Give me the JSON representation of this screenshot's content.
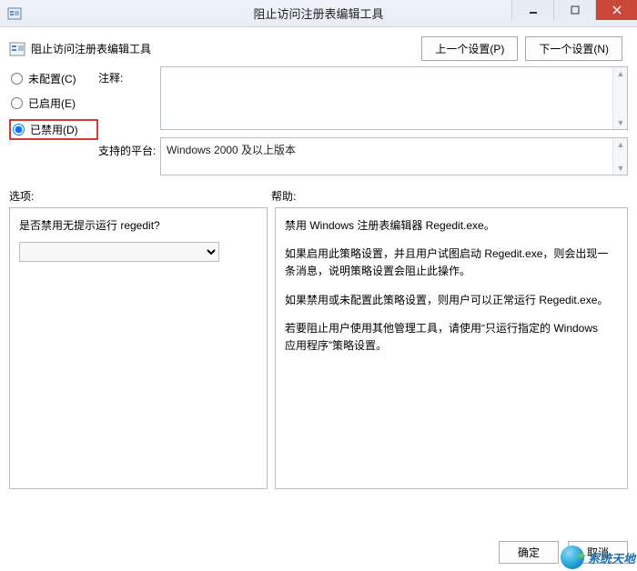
{
  "window": {
    "title": "阻止访问注册表编辑工具"
  },
  "policy": {
    "title": "阻止访问注册表编辑工具"
  },
  "nav": {
    "prev": "上一个设置(P)",
    "next": "下一个设置(N)"
  },
  "radios": {
    "not_configured": "未配置(C)",
    "enabled": "已启用(E)",
    "disabled": "已禁用(D)",
    "selected": "disabled"
  },
  "labels": {
    "comment": "注释:",
    "supported_on": "支持的平台:",
    "options": "选项:",
    "help": "帮助:"
  },
  "comment": "",
  "supported_on": "Windows 2000 及以上版本",
  "options": {
    "question": "是否禁用无提示运行 regedit?",
    "selected": ""
  },
  "help": {
    "p1": "禁用 Windows 注册表编辑器 Regedit.exe。",
    "p2": "如果启用此策略设置，并且用户试图启动 Regedit.exe，则会出现一条消息，说明策略设置会阻止此操作。",
    "p3": "如果禁用或未配置此策略设置，则用户可以正常运行 Regedit.exe。",
    "p4": "若要阻止用户使用其他管理工具，请使用“只运行指定的 Windows 应用程序”策略设置。"
  },
  "footer": {
    "ok": "确定",
    "cancel": "取消"
  },
  "watermark": {
    "text": "系统天地"
  }
}
